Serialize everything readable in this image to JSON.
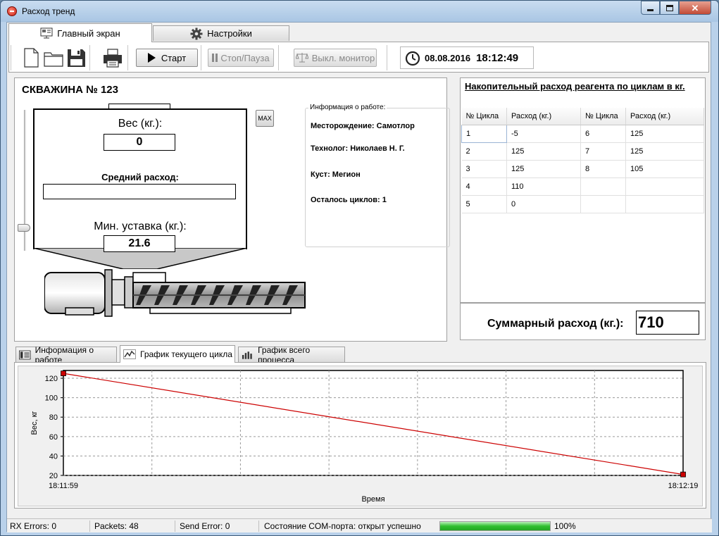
{
  "window": {
    "title": "Расход тренд"
  },
  "tabs": [
    {
      "label": "Главный экран",
      "icon": "screen-icon"
    },
    {
      "label": "Настройки",
      "icon": "gear-icon"
    }
  ],
  "toolbar": {
    "start_label": "Старт",
    "pause_label": "Стоп/Пауза",
    "monitor_label": "Выкл. монитор",
    "date": "08.08.2016",
    "time": "18:12:49"
  },
  "well": {
    "title": "СКВАЖИНА № 123",
    "weight_label": "Вес (кг.):",
    "weight_value": "0",
    "avg_label": "Средний расход:",
    "avg_value": "",
    "min_label": "Мин. уставка (кг.):",
    "min_value": "21.6",
    "max_label": "MAX"
  },
  "info": {
    "title": "Информация о работе:",
    "field": "Месторождение: Самотлор",
    "technologist": "Технолог: Николаев Н. Г.",
    "pad": "Куст:  Мегион",
    "cycles_left": "Осталось циклов: 1"
  },
  "consumption": {
    "title": "Накопительный расход реагента по циклам  в кг.",
    "headers": [
      "№ Цикла",
      "Расход (кг.)",
      "№ Цикла",
      "Расход (кг.)"
    ],
    "rows": [
      [
        "1",
        "-5",
        "6",
        "125"
      ],
      [
        "2",
        "125",
        "7",
        "125"
      ],
      [
        "3",
        "125",
        "8",
        "105"
      ],
      [
        "4",
        "110",
        "",
        ""
      ],
      [
        "5",
        "0",
        "",
        ""
      ]
    ],
    "total_label": "Суммарный расход (кг.):",
    "total_value": "710"
  },
  "subtabs": [
    {
      "label": "Информация о работе"
    },
    {
      "label": "График текущего цикла"
    },
    {
      "label": "График всего процесса"
    }
  ],
  "chart_data": {
    "type": "line",
    "x": [
      "18:11:59",
      "18:12:19"
    ],
    "series": [
      {
        "values": [
          125,
          21
        ]
      }
    ],
    "xlabel": "Время",
    "ylabel": "Вес, кг",
    "yticks": [
      20,
      40,
      60,
      80,
      100,
      120
    ],
    "ylim": [
      20,
      128
    ],
    "grid": true,
    "colors": {
      "line": "#cc0000",
      "marker": "#cc0000"
    }
  },
  "status": {
    "rx_errors": "RX Errors: 0",
    "packets": "Packets: 48",
    "send_error": "Send Error: 0",
    "com_state": "Состояние COM-порта: открыт успешно",
    "progress": 1.0,
    "progress_text": "100%"
  }
}
